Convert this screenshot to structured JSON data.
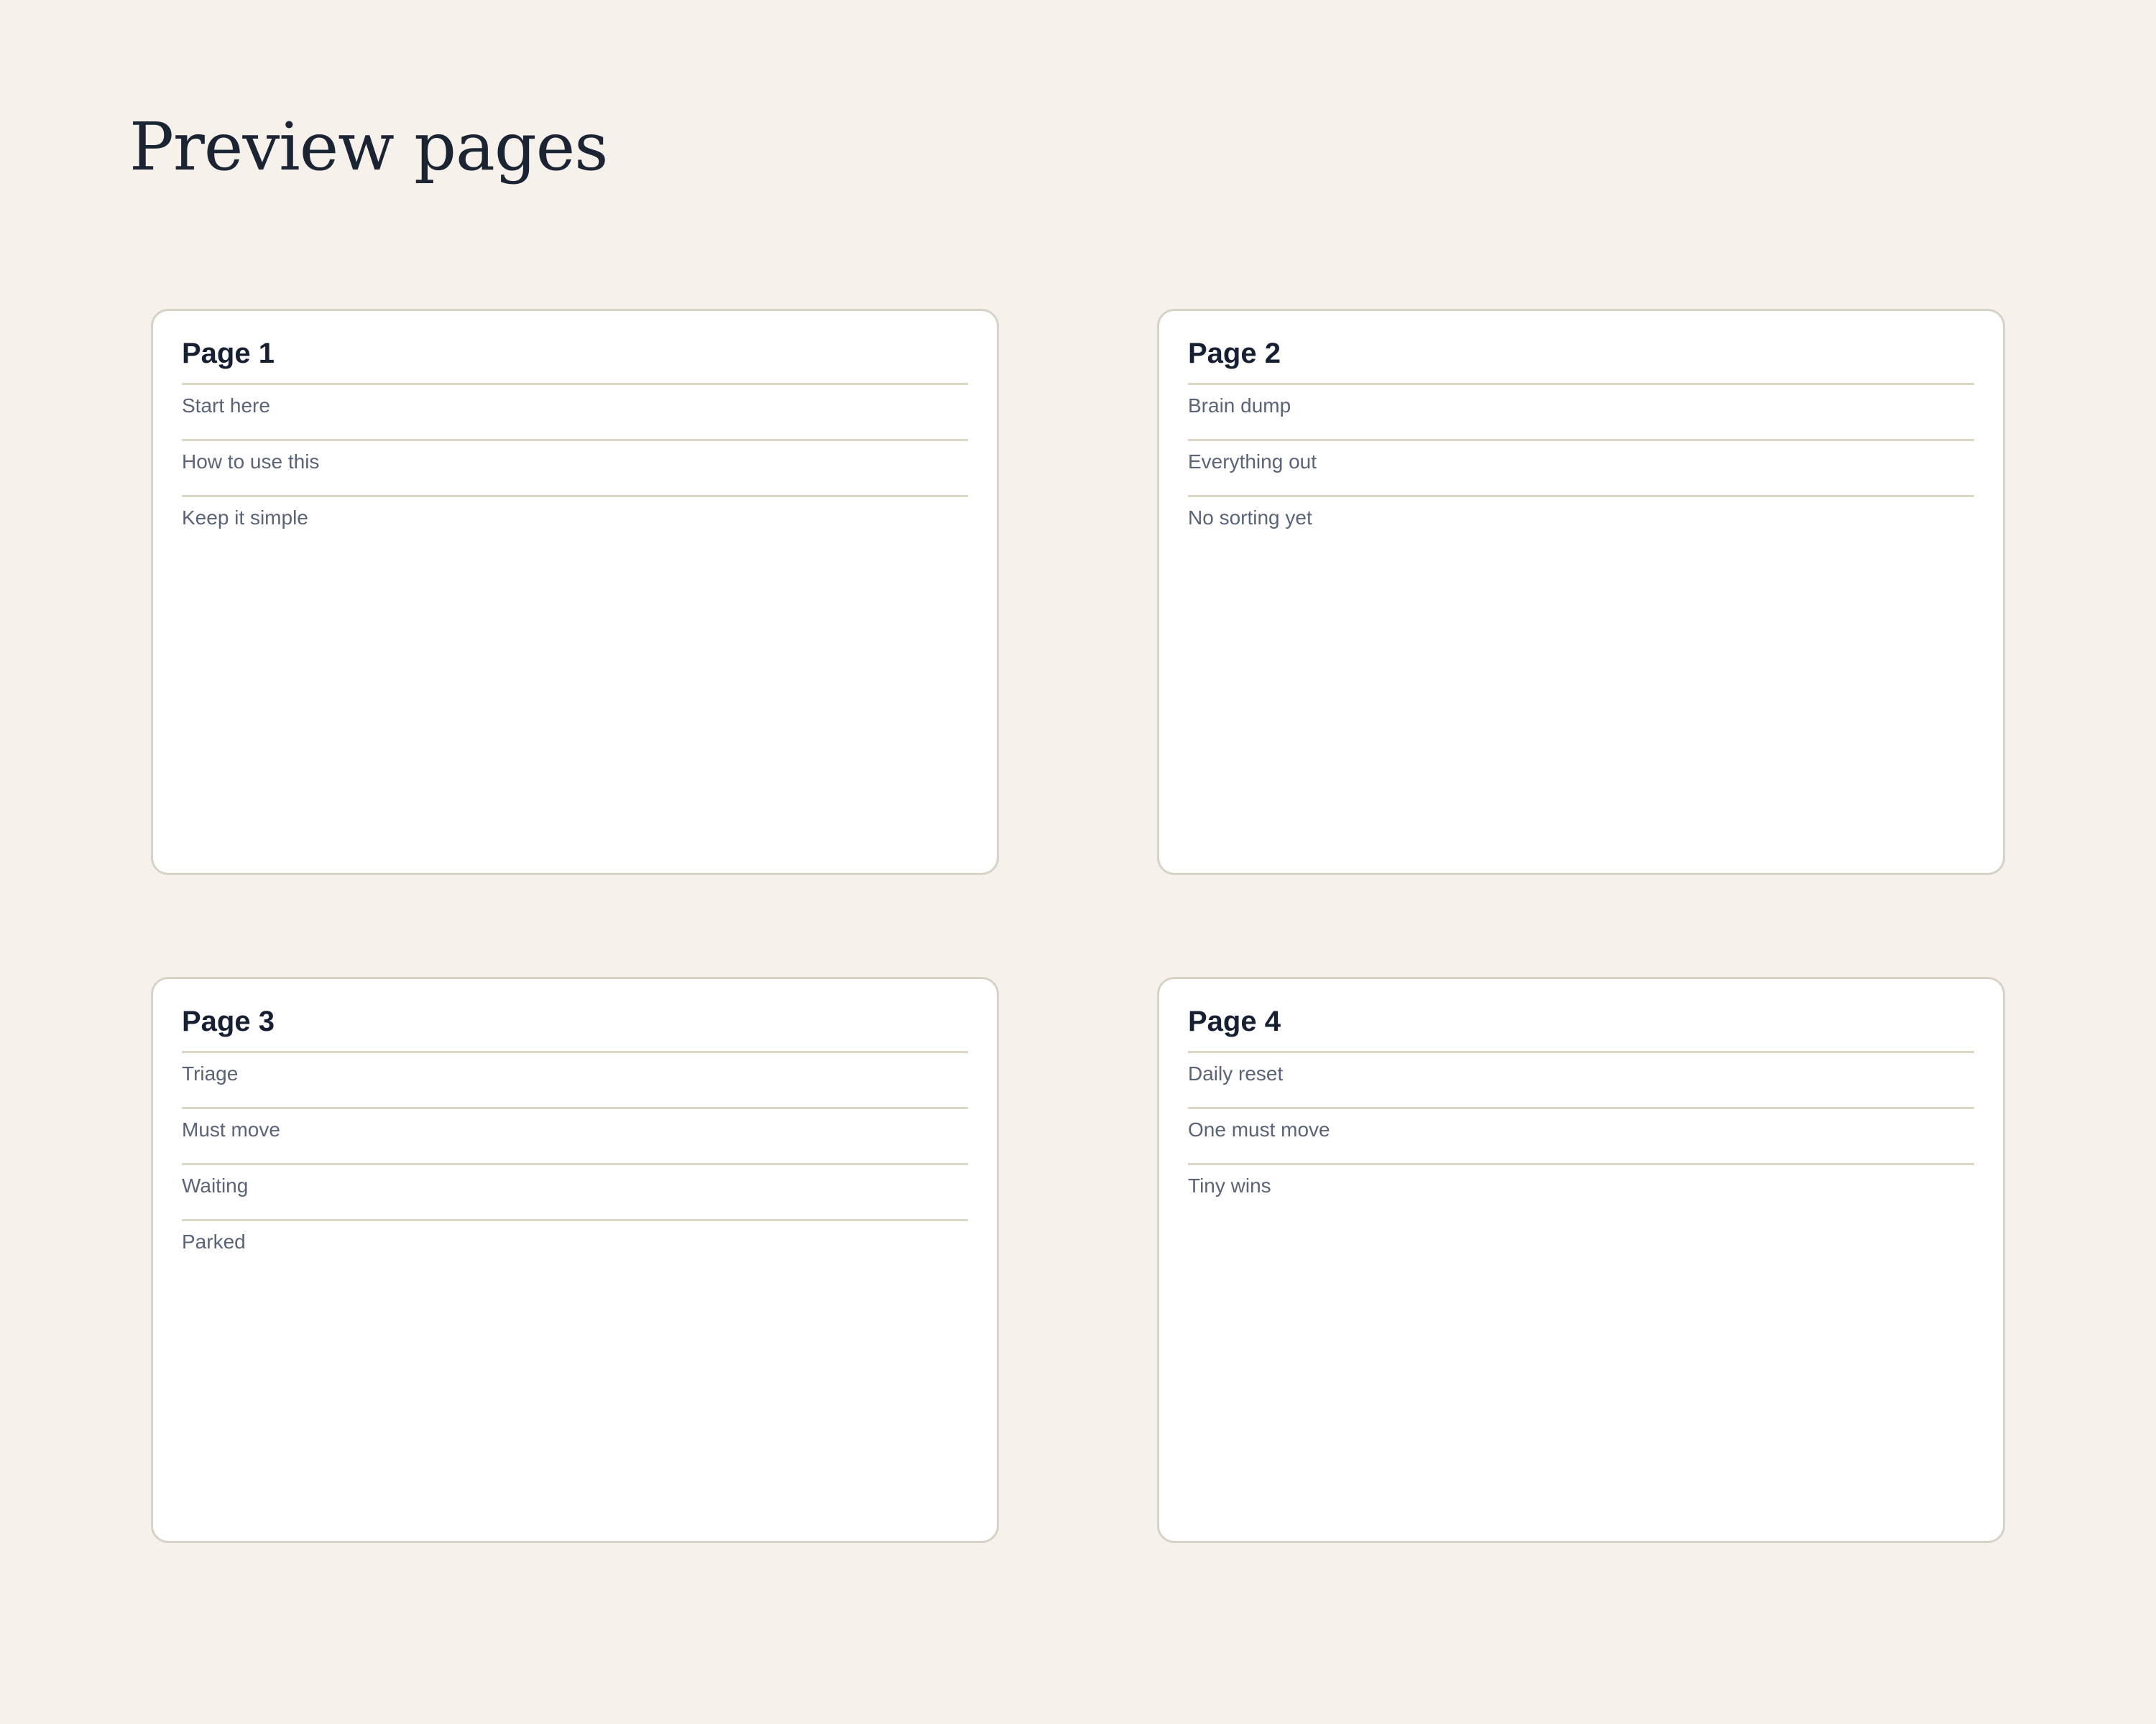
{
  "heading": "Preview pages",
  "pages": [
    {
      "title": "Page 1",
      "items": [
        "Start here",
        "How to use this",
        "Keep it simple"
      ]
    },
    {
      "title": "Page 2",
      "items": [
        "Brain dump",
        "Everything out",
        "No sorting yet"
      ]
    },
    {
      "title": "Page 3",
      "items": [
        "Triage",
        "Must move",
        "Waiting",
        "Parked"
      ]
    },
    {
      "title": "Page 4",
      "items": [
        "Daily reset",
        "One must move",
        "Tiny wins"
      ]
    }
  ]
}
